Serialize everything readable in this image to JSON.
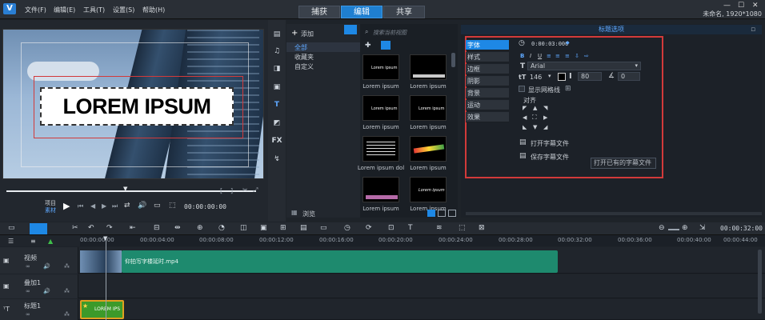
{
  "app": {
    "logo": "V",
    "window_title": "未命名, 1920*1080"
  },
  "menu": [
    "文件(F)",
    "编辑(E)",
    "工具(T)",
    "设置(S)",
    "帮助(H)"
  ],
  "workspace_tabs": [
    {
      "label": "捕获",
      "active": false
    },
    {
      "label": "编辑",
      "active": true
    },
    {
      "label": "共享",
      "active": false
    }
  ],
  "preview": {
    "title_text": "LOREM IPSUM",
    "mode_labels": {
      "project": "项目",
      "clip": "素材"
    },
    "timecode": "00:00:00:00"
  },
  "library": {
    "add_label": "添加",
    "folders": [
      {
        "label": "全部",
        "selected": true
      },
      {
        "label": "收藏夹",
        "selected": false
      },
      {
        "label": "自定义",
        "selected": false
      }
    ],
    "browse_label": "浏览",
    "search_placeholder": "搜索当前视图",
    "thumbnails": [
      {
        "label": "Lorem ipsum",
        "style": "small-text"
      },
      {
        "label": "Lorem ipsum",
        "style": "bar-text"
      },
      {
        "label": "Lorem ipsum",
        "style": "small-text"
      },
      {
        "label": "Lorem ipsum",
        "style": "small-text"
      },
      {
        "label": "Lorem ipsum dol",
        "style": "multi-line"
      },
      {
        "label": "Lorem ipsum",
        "style": "colorful"
      },
      {
        "label": "Lorem ipsum",
        "style": "pink-bar"
      },
      {
        "label": "Lorem ipsum",
        "style": "small-text"
      }
    ]
  },
  "title_options": {
    "header": "标题选项",
    "tabs": [
      {
        "label": "字体",
        "active": true
      },
      {
        "label": "样式"
      },
      {
        "label": "边框"
      },
      {
        "label": "阴影"
      },
      {
        "label": "背景"
      },
      {
        "label": "运动"
      },
      {
        "label": "效果"
      }
    ],
    "duration": "0:00:03:000",
    "font_name": "Arial",
    "font_size": "146",
    "line_spacing": "80",
    "rotation": "0",
    "show_grid_label": "显示网格线",
    "align_label": "对齐",
    "open_subtitle": "打开字幕文件",
    "save_subtitle": "保存字幕文件",
    "tooltip": "打开已有的字幕文件",
    "text_color": "#000000"
  },
  "timeline": {
    "current_time": "00:00:32:00",
    "ruler_ticks": [
      "00:00:00:00",
      "00:00:04:00",
      "00:00:08:00",
      "00:00:12:00",
      "00:00:16:00",
      "00:00:20:00",
      "00:00:24:00",
      "00:00:28:00",
      "00:00:32:00",
      "00:00:36:00",
      "00:00:40:00",
      "00:00:44:00"
    ],
    "tracks": [
      {
        "name": "视频",
        "clip_label": "仰拍写字楼延时.mp4"
      },
      {
        "name": "叠加1",
        "clip_label": ""
      },
      {
        "name": "标题1",
        "clip_label": "LOREM IPS"
      }
    ]
  },
  "colors": {
    "accent": "#1e88e5",
    "video_clip": "#1e8a6e",
    "title_clip": "#3c9a2a",
    "highlight_box": "#d23a3a"
  }
}
